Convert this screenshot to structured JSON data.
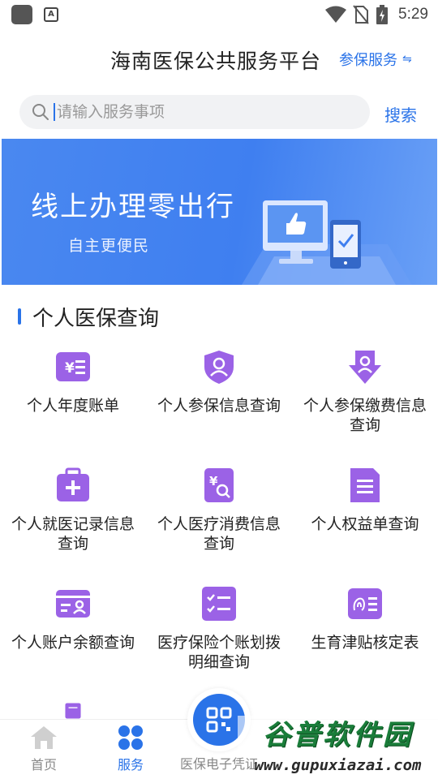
{
  "status_bar": {
    "time": "5:29"
  },
  "header": {
    "title": "海南医保公共服务平台",
    "insured_service": "参保服务",
    "swap_glyph": "⇋"
  },
  "search": {
    "placeholder": "请输入服务事项",
    "button": "搜索"
  },
  "banner": {
    "title": "线上办理零出行",
    "subtitle": "自主更便民"
  },
  "section": {
    "title": "个人医保查询"
  },
  "services": [
    {
      "label": "个人年度账单",
      "icon": "yuan-list-icon"
    },
    {
      "label": "个人参保信息查询",
      "icon": "shield-person-icon"
    },
    {
      "label": "个人参保缴费信息查询",
      "icon": "arrow-down-person-icon"
    },
    {
      "label": "个人就医记录信息查询",
      "icon": "medical-kit-icon"
    },
    {
      "label": "个人医疗消费信息查询",
      "icon": "yuan-search-icon"
    },
    {
      "label": "个人权益单查询",
      "icon": "document-icon"
    },
    {
      "label": "个人账户余额查询",
      "icon": "id-card-icon"
    },
    {
      "label": "医疗保险个账划拨明细查询",
      "icon": "checklist-icon"
    },
    {
      "label": "生育津贴核定表",
      "icon": "fingerprint-list-icon"
    }
  ],
  "bottom_nav": {
    "home": "首页",
    "services": "服务",
    "e_voucher": "医保电子凭证"
  },
  "watermark": {
    "name": "谷普软件园",
    "url": "www.gupuxiazai.com"
  },
  "colors": {
    "accent": "#2a73e8",
    "icon_purple": "#9b62e6",
    "banner": "#4a88f0"
  }
}
